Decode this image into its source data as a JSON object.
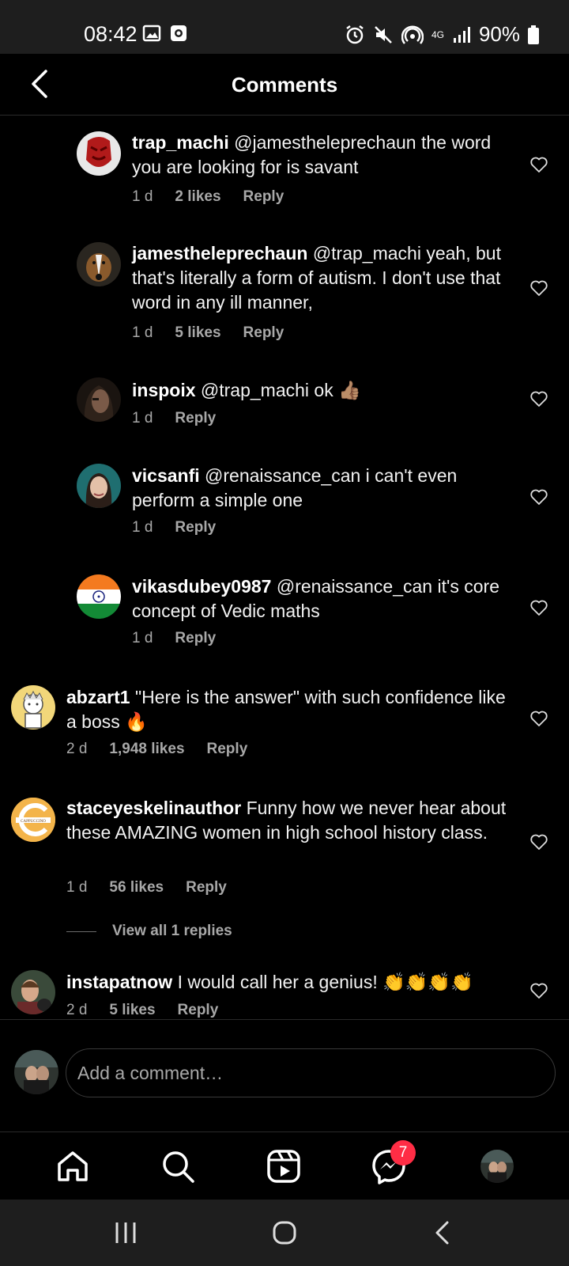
{
  "status_bar": {
    "time": "08:42",
    "network": "4G",
    "battery": "90%"
  },
  "header": {
    "title": "Comments"
  },
  "comments": [
    {
      "username": "trap_machi",
      "text": "@jamestheleprechaun the word you are looking for is savant",
      "age": "1 d",
      "likes": "2 likes",
      "reply": "Reply"
    },
    {
      "username": "jamestheleprechaun",
      "text": "@trap_machi yeah, but that's literally a form of autism. I don't use that word in any ill manner,",
      "age": "1 d",
      "likes": "5 likes",
      "reply": "Reply"
    },
    {
      "username": "inspoix",
      "text": "@trap_machi ok 👍🏽",
      "age": "1 d",
      "reply": "Reply"
    },
    {
      "username": "vicsanfi",
      "text": "@renaissance_can i can't even perform a simple one",
      "age": "1 d",
      "reply": "Reply"
    },
    {
      "username": "vikasdubey0987",
      "text": "@renaissance_can it's core concept of Vedic maths",
      "age": "1 d",
      "reply": "Reply"
    },
    {
      "username": "abzart1",
      "text": "\"Here is the answer\" with such confidence like a boss 🔥",
      "age": "2 d",
      "likes": "1,948 likes",
      "reply": "Reply"
    },
    {
      "username": "staceyeskelinauthor",
      "text": "Funny how we never hear about these AMAZING women in high school history class.",
      "age": "1 d",
      "likes": "56 likes",
      "reply": "Reply",
      "avatar_text": "CAPPUCCINO"
    },
    {
      "username": "instapatnow",
      "text": "I would call her a genius! 👏👏👏👏",
      "age": "2 d",
      "likes": "5 likes",
      "reply": "Reply"
    }
  ],
  "view_replies": "View all 1 replies",
  "compose": {
    "placeholder": "Add a comment…"
  },
  "bottom_nav": {
    "messages_badge": "7"
  },
  "icons": [
    "back-arrow-icon",
    "heart-icon",
    "home-icon",
    "search-icon",
    "reels-icon",
    "messenger-icon",
    "recents-icon",
    "home-circle-icon",
    "back-chevron-icon"
  ],
  "colors": {
    "background": "#000000",
    "text": "#ffffff",
    "muted": "#a8a8a8",
    "badge": "#ff2d45"
  }
}
